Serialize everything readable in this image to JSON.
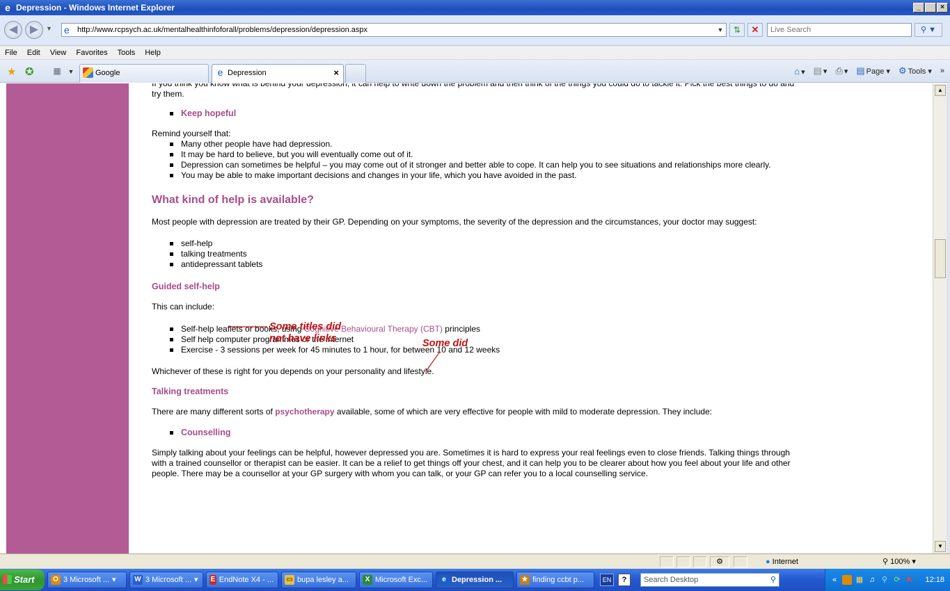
{
  "window": {
    "title": "Depression - Windows Internet Explorer",
    "minimize": "_",
    "maximize": " ",
    "close": "×"
  },
  "address": {
    "url": "http://www.rcpsych.ac.uk/mentalhealthinfoforall/problems/depression/depression.aspx",
    "search_placeholder": "Live Search"
  },
  "menu": [
    "File",
    "Edit",
    "View",
    "Favorites",
    "Tools",
    "Help"
  ],
  "tabs": [
    {
      "label": "Google"
    },
    {
      "label": "Depression",
      "close": "×"
    }
  ],
  "command_bar": {
    "page": "Page",
    "tools": "Tools",
    "more": "»"
  },
  "article": {
    "cut_text": "If you think you know what is behind your depression, it can help to write down the problem and then think of the things you could do to tackle it. Pick the best things to do and try them.",
    "keep_hopeful": "Keep hopeful",
    "remind": "Remind yourself that:",
    "remind_items": [
      "Many other people have had depression.",
      "It may be hard to believe, but you will eventually come out of it.",
      "Depression can sometimes be helpful – you may come out of it stronger and better able to cope. It can help you to see situations and relationships more clearly.",
      "You may be able to make important decisions and changes in your life, which you have avoided in the past."
    ],
    "help_heading": "What kind of help is available?",
    "help_intro": "Most people with depression are treated by their GP. Depending on your symptoms, the severity of the depression and the circumstances, your doctor may suggest:",
    "help_items": [
      "self-help",
      "talking treatments",
      "antidepressant tablets"
    ],
    "guided_heading": "Guided self-help",
    "can_include": "This can include:",
    "self_help_item_pre": "Self-help leaflets or books, using ",
    "cbt_link": "Cognitive Behavioural Therapy (CBT)",
    "self_help_item_post": " principles",
    "guided_items": [
      "Self help computer programmes or the internet",
      "Exercise - 3 sessions per week for 45 minutes to 1 hour, for between 10 and 12 weeks"
    ],
    "whichever": "Whichever of these is right for you depends on your personality and lifestyle.",
    "talking_heading": "Talking treatments",
    "talking_pre": "There are many different sorts of ",
    "psychotherapy_link": "psychotherapy",
    "talking_post": " available, some of which are very effective for people with mild to moderate depression. They include:",
    "counselling": "Counselling",
    "counselling_text": "Simply talking about your feelings can be helpful, however depressed you are. Sometimes it is hard to express your real feelings even to close friends. Talking things through with a trained counsellor or therapist can be easier. It can be a relief to get things off your chest, and it can help you to be clearer about how you feel about your life and other people.  There may be a counsellor at your GP surgery with whom you can talk, or your GP can refer you to a local counselling service."
  },
  "annotations": {
    "titles_line1": "Some titles did",
    "titles_line2": "not have links",
    "some_did": "Some did",
    "color": "#c41010"
  },
  "status": {
    "zone": "Internet",
    "zoom": "100%"
  },
  "taskbar": {
    "start": "Start",
    "tasks": [
      {
        "label": "3 Microsoft ...",
        "icon": "O",
        "color": "#e08a00"
      },
      {
        "label": "3 Microsoft ...",
        "icon": "W",
        "color": "#2a5bd4"
      },
      {
        "label": "EndNote X4 - ...",
        "icon": "E",
        "color": "#c03030"
      },
      {
        "label": "bupa lesley a...",
        "icon": "▭",
        "color": "#e8c040"
      },
      {
        "label": "Microsoft Exc...",
        "icon": "X",
        "color": "#2a8a3a"
      },
      {
        "label": "Depression ...",
        "icon": "e",
        "color": "#1a5fc8",
        "active": true
      },
      {
        "label": "finding ccbt p...",
        "icon": "★",
        "color": "#c08020"
      }
    ],
    "lang": "EN",
    "help": "?",
    "search_placeholder": "Search Desktop",
    "clock": "12:18"
  },
  "colors": {
    "sidebar": "#b35b95",
    "heading": "#a84d8a"
  }
}
